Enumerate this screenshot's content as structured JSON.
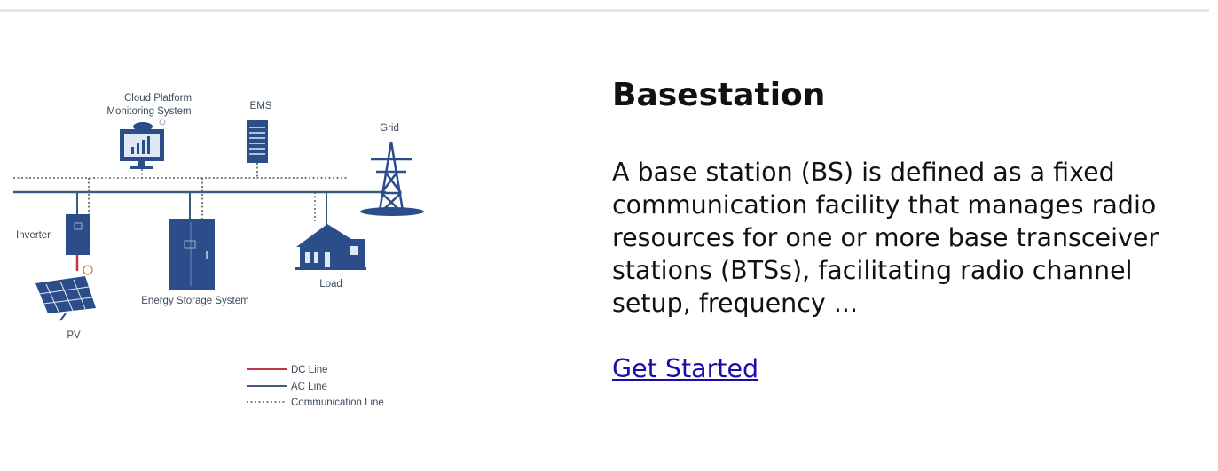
{
  "diagram": {
    "labels": {
      "cloud_platform_line1": "Cloud Platform",
      "cloud_platform_line2": "Monitoring System",
      "ems": "EMS",
      "grid": "Grid",
      "inverter": "Inverter",
      "load": "Load",
      "energy_storage": "Energy Storage System",
      "pv": "PV"
    },
    "legend": {
      "dc_line": "DC Line",
      "ac_line": "AC Line",
      "communication_line": "Communication Line"
    },
    "colors": {
      "equipment": "#2b4d8a",
      "ac_line": "#3d5a84",
      "dc_line": "#c0334a"
    }
  },
  "card": {
    "title": "Basestation",
    "description": "A base station (BS) is defined as a fixed communication facility that manages radio resources for one or more base transceiver stations (BTSs), facilitating radio channel setup, frequency ...",
    "cta_label": "Get Started"
  }
}
